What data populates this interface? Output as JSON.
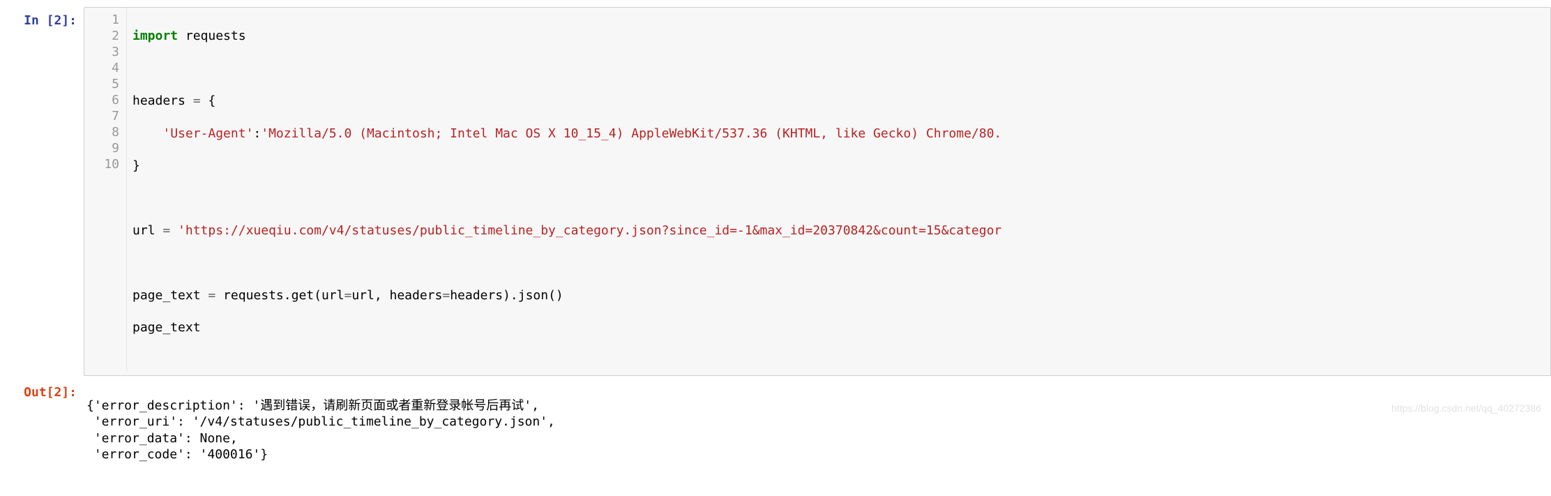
{
  "input_cell": {
    "prompt_label": "In [2]:",
    "line_numbers": [
      "1",
      "2",
      "3",
      "4",
      "5",
      "6",
      "7",
      "8",
      "9",
      "10"
    ],
    "code_tokens": {
      "kw_import": "import",
      "mod_requests": " requests",
      "l3_headers": "headers ",
      "eq": "=",
      "l3_brace": " {",
      "l4_indent": "    ",
      "l4_key": "'User-Agent'",
      "l4_colon": ":",
      "l4_val": "'Mozilla/5.0 (Macintosh; Intel Mac OS X 10_15_4) AppleWebKit/537.36 (KHTML, like Gecko) Chrome/80.",
      "l5_brace": "}",
      "l7_url": "url ",
      "l7_val": "'https://xueqiu.com/v4/statuses/public_timeline_by_category.json?since_id=-1&max_id=20370842&count=15&categor",
      "l9_pt": "page_text ",
      "l9_req": " requests",
      "l9_dot_get": ".get(url",
      "l9_arg_url": "url, headers",
      "l9_arg_hdr": "headers)",
      "l9_json": ".json()",
      "l10": "page_text"
    }
  },
  "output_cell": {
    "prompt_label": "Out[2]:",
    "lines": {
      "l1": "{'error_description': '遇到错误，请刷新页面或者重新登录帐号后再试',",
      "l2": " 'error_uri': '/v4/statuses/public_timeline_by_category.json',",
      "l3": " 'error_data': None,",
      "l4": " 'error_code': '400016'}"
    }
  },
  "watermark": "https://blog.csdn.net/qq_40272386"
}
